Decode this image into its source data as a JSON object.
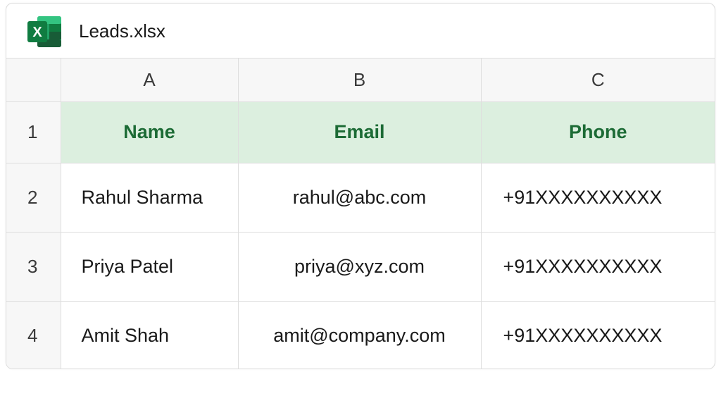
{
  "file": {
    "name": "Leads.xlsx",
    "icon": "excel-icon",
    "icon_letter": "X",
    "brand_color": "#1e7145"
  },
  "columns": [
    "A",
    "B",
    "C"
  ],
  "row_numbers": [
    "1",
    "2",
    "3",
    "4"
  ],
  "header": {
    "name": "Name",
    "email": "Email",
    "phone": "Phone",
    "fill_color": "#dcefdf",
    "text_color": "#1c6b35"
  },
  "rows": [
    {
      "name": "Rahul Sharma",
      "email": "rahul@abc.com",
      "phone": "+91XXXXXXXXXX"
    },
    {
      "name": "Priya Patel",
      "email": "priya@xyz.com",
      "phone": "+91XXXXXXXXXX"
    },
    {
      "name": "Amit Shah",
      "email": "amit@company.com",
      "phone": "+91XXXXXXXXXX"
    }
  ]
}
